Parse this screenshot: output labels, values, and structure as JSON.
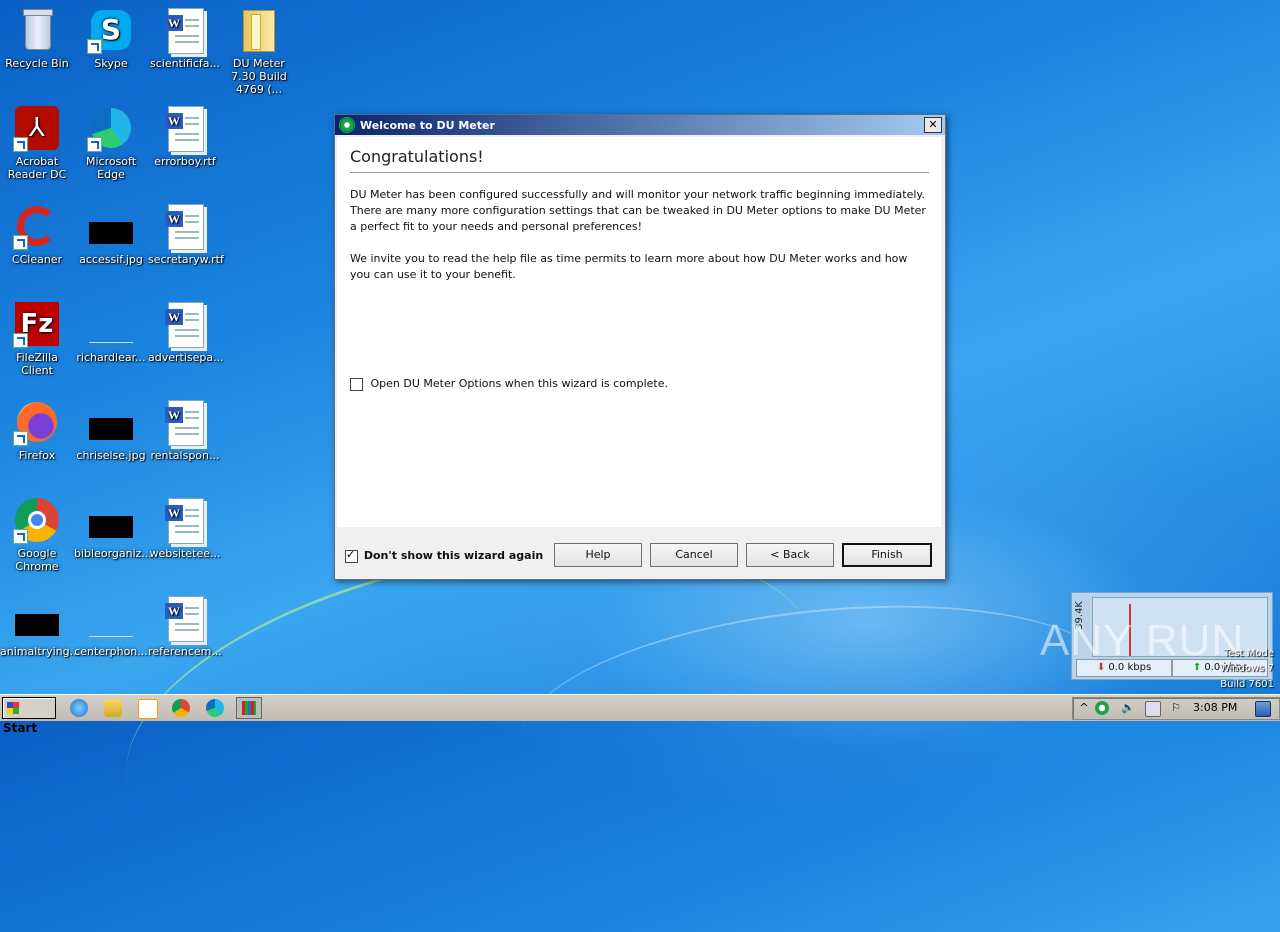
{
  "desktop": {
    "icons": [
      {
        "label": "Recycle Bin"
      },
      {
        "label": "Skype"
      },
      {
        "label": "scientificfa..."
      },
      {
        "label": "DU Meter 7.30 Build 4769 (..."
      },
      {
        "label": "Acrobat Reader DC"
      },
      {
        "label": "Microsoft Edge"
      },
      {
        "label": "errorboy.rtf"
      },
      {
        "label": "CCleaner"
      },
      {
        "label": "accessif.jpg"
      },
      {
        "label": "secretaryw.rtf"
      },
      {
        "label": "FileZilla Client"
      },
      {
        "label": "richardlear..."
      },
      {
        "label": "advertisepa..."
      },
      {
        "label": "Firefox"
      },
      {
        "label": "chriselse.jpg"
      },
      {
        "label": "rentalspon..."
      },
      {
        "label": "Google Chrome"
      },
      {
        "label": "bibleorganiz..."
      },
      {
        "label": "websitetee..."
      },
      {
        "label": "animaltrying..."
      },
      {
        "label": "centerphon..."
      },
      {
        "label": "referencem..."
      }
    ]
  },
  "dialog": {
    "title": "Welcome to DU Meter",
    "close_label": "✕",
    "heading": "Congratulations!",
    "para1": "DU Meter has been configured successfully and will monitor your network traffic beginning immediately. There are many more configuration settings that can be tweaked in DU Meter options to make DU Meter a perfect fit to your needs and personal preferences!",
    "para2": "We invite you to read the help file as time permits to learn more about how DU Meter works and how you can use it to your benefit.",
    "option_label": "Open DU Meter Options when this wizard is complete.",
    "option_checked": false,
    "dont_show_label": "Don't show this wizard again",
    "dont_show_checked": true,
    "buttons": {
      "help": "Help",
      "cancel": "Cancel",
      "back": "< Back",
      "finish": "Finish"
    }
  },
  "du_widget": {
    "scale_label": "39.4K",
    "download_rate": "0.0 kbps",
    "upload_rate": "0.0 kbps"
  },
  "watermark": "ANY RUN",
  "os_tag": {
    "line1": "Test Mode",
    "line2": "Windows 7",
    "line3": "Build 7601"
  },
  "taskbar": {
    "start_label": "Start",
    "clock": "3:08 PM"
  }
}
